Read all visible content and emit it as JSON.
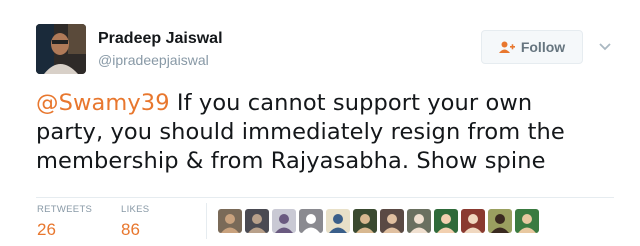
{
  "user": {
    "name": "Pradeep Jaiswal",
    "handle": "@ipradeepjaiswal"
  },
  "follow": {
    "label": "Follow"
  },
  "tweet": {
    "mention": "@Swamy39",
    "text": " If you cannot support your own party, you should immediately resign from the membership & from Rajyasabha. Show spine"
  },
  "stats": {
    "retweets_label": "RETWEETS",
    "retweets_value": "26",
    "likes_label": "LIKES",
    "likes_value": "86"
  },
  "colors": {
    "accent": "#e8772e",
    "secondary": "#8899a6",
    "divider": "#e6ecf0"
  },
  "likers": [
    {
      "bg": "#7a6a58",
      "fg": "#c9a27e"
    },
    {
      "bg": "#4a4a52",
      "fg": "#b8a08a"
    },
    {
      "bg": "#c9c9d4",
      "fg": "#6a5a80"
    },
    {
      "bg": "#8a8a90",
      "fg": "#ffffff"
    },
    {
      "bg": "#e8e0c8",
      "fg": "#3a5f8a"
    },
    {
      "bg": "#3a4a30",
      "fg": "#d8b890"
    },
    {
      "bg": "#5a4a44",
      "fg": "#e0c0a0"
    },
    {
      "bg": "#6a7060",
      "fg": "#f0e0d0"
    },
    {
      "bg": "#2f6a3a",
      "fg": "#f2d0b0"
    },
    {
      "bg": "#8a3a30",
      "fg": "#f0d8c0"
    },
    {
      "bg": "#9aa060",
      "fg": "#3a2a20"
    },
    {
      "bg": "#3a7a40",
      "fg": "#e8c8a0"
    }
  ]
}
